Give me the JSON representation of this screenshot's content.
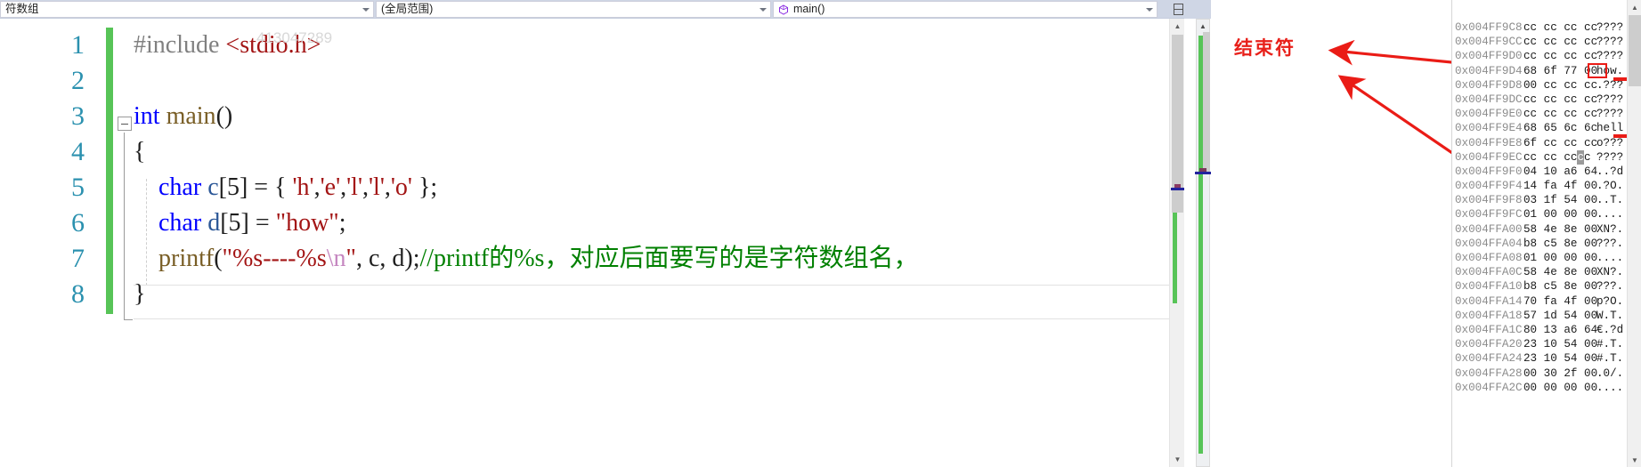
{
  "navbar": {
    "scope_selector": {
      "value": "符数组",
      "icon": "chevron-down-icon"
    },
    "global_scope": {
      "value": "(全局范围)",
      "icon": "chevron-down-icon"
    },
    "function_selector": {
      "value": "main()",
      "icon": "function-icon"
    },
    "splitter_icon": "split-window-icon"
  },
  "editor": {
    "line_numbers": [
      "1",
      "2",
      "3",
      "4",
      "5",
      "6",
      "7",
      "8"
    ],
    "watermark": "413047289",
    "lines": [
      {
        "number": "1",
        "tokens": [
          {
            "text": "#include ",
            "type": "preprocessor"
          },
          {
            "text": "<stdio.h>",
            "type": "header"
          }
        ]
      },
      {
        "number": "2",
        "tokens": []
      },
      {
        "number": "3",
        "tokens": [
          {
            "text": "int",
            "type": "keyword"
          },
          {
            "text": " ",
            "type": "plain"
          },
          {
            "text": "main",
            "type": "function"
          },
          {
            "text": "()",
            "type": "punct"
          }
        ]
      },
      {
        "number": "4",
        "tokens": [
          {
            "text": "{",
            "type": "punct"
          }
        ]
      },
      {
        "number": "5",
        "tokens": [
          {
            "text": "    ",
            "type": "plain"
          },
          {
            "text": "char",
            "type": "keyword"
          },
          {
            "text": " ",
            "type": "plain"
          },
          {
            "text": "c",
            "type": "variable"
          },
          {
            "text": "[",
            "type": "punct"
          },
          {
            "text": "5",
            "type": "number"
          },
          {
            "text": "]",
            "type": "punct"
          },
          {
            "text": " = { ",
            "type": "punct"
          },
          {
            "text": "'h'",
            "type": "string"
          },
          {
            "text": ",",
            "type": "punct"
          },
          {
            "text": "'e'",
            "type": "string"
          },
          {
            "text": ",",
            "type": "punct"
          },
          {
            "text": "'l'",
            "type": "string"
          },
          {
            "text": ",",
            "type": "punct"
          },
          {
            "text": "'l'",
            "type": "string"
          },
          {
            "text": ",",
            "type": "punct"
          },
          {
            "text": "'o'",
            "type": "string"
          },
          {
            "text": " };",
            "type": "punct"
          }
        ]
      },
      {
        "number": "6",
        "tokens": [
          {
            "text": "    ",
            "type": "plain"
          },
          {
            "text": "char",
            "type": "keyword"
          },
          {
            "text": " ",
            "type": "plain"
          },
          {
            "text": "d",
            "type": "variable"
          },
          {
            "text": "[",
            "type": "punct"
          },
          {
            "text": "5",
            "type": "number"
          },
          {
            "text": "]",
            "type": "punct"
          },
          {
            "text": " = ",
            "type": "punct"
          },
          {
            "text": "\"how\"",
            "type": "string"
          },
          {
            "text": ";",
            "type": "punct"
          }
        ]
      },
      {
        "number": "7",
        "tokens": [
          {
            "text": "    ",
            "type": "plain"
          },
          {
            "text": "printf",
            "type": "function"
          },
          {
            "text": "(",
            "type": "punct"
          },
          {
            "text": "\"%s----%s",
            "type": "string"
          },
          {
            "text": "\\n",
            "type": "escape"
          },
          {
            "text": "\"",
            "type": "string"
          },
          {
            "text": ", c, d);",
            "type": "punct"
          },
          {
            "text": "//printf的%s，对应后面要写的是字符数组名，",
            "type": "comment"
          }
        ]
      },
      {
        "number": "8",
        "tokens": [
          {
            "text": "}",
            "type": "punct"
          }
        ]
      }
    ],
    "scrollbar": {
      "up_icon": "scroll-up-icon",
      "down_icon": "scroll-down-icon"
    }
  },
  "annotation": {
    "label": "结束符",
    "color": "#e8201a",
    "arrow_count": 2
  },
  "memory": {
    "columns": [
      "address",
      "bytes",
      "ascii"
    ],
    "scrollbar": {
      "up_icon": "scroll-up-icon",
      "down_icon": "scroll-down-icon"
    },
    "highlight": {
      "byte": "00",
      "row_address": "0x004FF9D4",
      "color": "#ea1c16"
    },
    "rows": [
      {
        "address": "0x004FF9C8",
        "bytes": "cc cc cc cc",
        "ascii": "????"
      },
      {
        "address": "0x004FF9CC",
        "bytes": "cc cc cc cc",
        "ascii": "????"
      },
      {
        "address": "0x004FF9D0",
        "bytes": "cc cc cc cc",
        "ascii": "????"
      },
      {
        "address": "0x004FF9D4",
        "bytes": "68 6f 77 00",
        "ascii": "how."
      },
      {
        "address": "0x004FF9D8",
        "bytes": "00 cc cc cc",
        "ascii": ".???"
      },
      {
        "address": "0x004FF9DC",
        "bytes": "cc cc cc cc",
        "ascii": "????"
      },
      {
        "address": "0x004FF9E0",
        "bytes": "cc cc cc cc",
        "ascii": "????"
      },
      {
        "address": "0x004FF9E4",
        "bytes": "68 65 6c 6c",
        "ascii": "hell"
      },
      {
        "address": "0x004FF9E8",
        "bytes": "6f cc cc cc",
        "ascii": "o???"
      },
      {
        "address": "0x004FF9EC",
        "bytes": "cc cc cc cc",
        "ascii": "????"
      },
      {
        "address": "0x004FF9F0",
        "bytes": "04 10 a6 64",
        "ascii": "..?d"
      },
      {
        "address": "0x004FF9F4",
        "bytes": "14 fa 4f 00",
        "ascii": ".?O."
      },
      {
        "address": "0x004FF9F8",
        "bytes": "03 1f 54 00",
        "ascii": "..T."
      },
      {
        "address": "0x004FF9FC",
        "bytes": "01 00 00 00",
        "ascii": "...."
      },
      {
        "address": "0x004FFA00",
        "bytes": "58 4e 8e 00",
        "ascii": "XN?."
      },
      {
        "address": "0x004FFA04",
        "bytes": "b8 c5 8e 00",
        "ascii": "???."
      },
      {
        "address": "0x004FFA08",
        "bytes": "01 00 00 00",
        "ascii": "...."
      },
      {
        "address": "0x004FFA0C",
        "bytes": "58 4e 8e 00",
        "ascii": "XN?."
      },
      {
        "address": "0x004FFA10",
        "bytes": "b8 c5 8e 00",
        "ascii": "???."
      },
      {
        "address": "0x004FFA14",
        "bytes": "70 fa 4f 00",
        "ascii": "p?O."
      },
      {
        "address": "0x004FFA18",
        "bytes": "57 1d 54 00",
        "ascii": "W.T."
      },
      {
        "address": "0x004FFA1C",
        "bytes": "80 13 a6 64",
        "ascii": "€.?d"
      },
      {
        "address": "0x004FFA20",
        "bytes": "23 10 54 00",
        "ascii": "#.T."
      },
      {
        "address": "0x004FFA24",
        "bytes": "23 10 54 00",
        "ascii": "#.T."
      },
      {
        "address": "0x004FFA28",
        "bytes": "00 30 2f 00",
        "ascii": ".0/."
      },
      {
        "address": "0x004FFA2C",
        "bytes": "00 00 00 00",
        "ascii": "...."
      }
    ]
  }
}
